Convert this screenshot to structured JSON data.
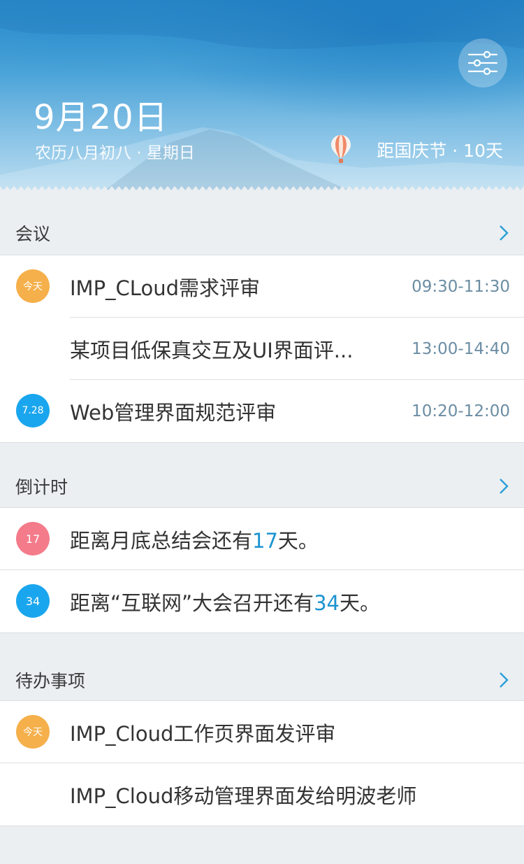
{
  "header": {
    "date": "9月20日",
    "lunar": "农历八月初八 · 星期日",
    "holiday": "距国庆节 · 10天",
    "filter_icon": "sliders-icon",
    "balloon_icon": "hot-air-balloon-icon"
  },
  "meetings": {
    "title": "会议",
    "items": [
      {
        "badge": "今天",
        "badge_color": "#f5b04b",
        "title": "IMP_CLoud需求评审",
        "time": "09:30-11:30"
      },
      {
        "badge": "",
        "title": "某项目低保真交互及UI界面评...",
        "time": "13:00-14:40"
      },
      {
        "badge": "7.28",
        "badge_color": "#1aa6ee",
        "title": "Web管理界面规范评审",
        "time": "10:20-12:00"
      }
    ]
  },
  "countdown": {
    "title": "倒计时",
    "items": [
      {
        "badge": "17",
        "badge_color": "#f47b8a",
        "prefix": "距离月底总结会还有",
        "days": "17",
        "suffix": "天。"
      },
      {
        "badge": "34",
        "badge_color": "#1aa6ee",
        "prefix": "距离“互联网”大会召开还有",
        "days": "34",
        "suffix": "天。"
      }
    ]
  },
  "todos": {
    "title": "待办事项",
    "items": [
      {
        "badge": "今天",
        "badge_color": "#f5b04b",
        "title": "IMP_Cloud工作页界面发评审"
      },
      {
        "badge": "",
        "title": "IMP_Cloud移动管理界面发给明波老师"
      }
    ]
  },
  "colors": {
    "accent": "#1c93d0",
    "chevron": "#2a9fd8",
    "background": "#ebeff2"
  }
}
